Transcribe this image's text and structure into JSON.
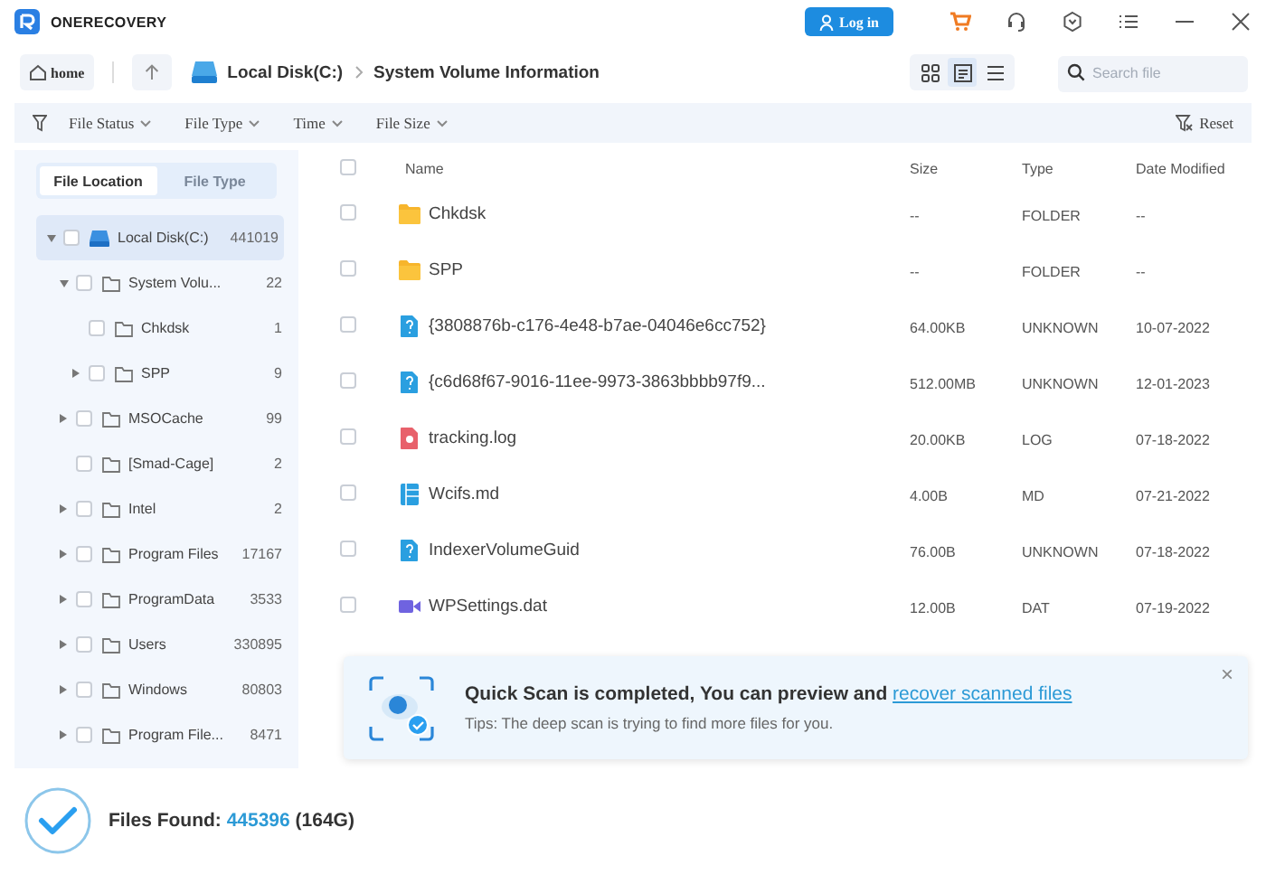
{
  "app": {
    "name": "ONERECOVERY"
  },
  "header": {
    "login": "Log in"
  },
  "toolbar": {
    "home": "home",
    "path": [
      {
        "label": "Local Disk(C:)",
        "kind": "disk"
      },
      {
        "label": "System Volume Information",
        "kind": "folder"
      }
    ],
    "views": [
      {
        "kind": "grid",
        "selected": false
      },
      {
        "kind": "detail",
        "selected": true
      },
      {
        "kind": "list",
        "selected": false
      }
    ],
    "search": {
      "placeholder": "Search file"
    }
  },
  "filters": [
    {
      "label": "File Status"
    },
    {
      "label": "File Type"
    },
    {
      "label": "Time"
    },
    {
      "label": "File Size"
    }
  ],
  "reset": "Reset",
  "sidebar": {
    "tabs": [
      {
        "label": "File Location",
        "selected": true
      },
      {
        "label": "File Type",
        "selected": false
      }
    ],
    "tree": [
      {
        "label": "Local Disk(C:)",
        "count": "441019",
        "kind": "disk",
        "selected": true,
        "checked": false,
        "expandable": true,
        "expanded": true,
        "children": [
          {
            "label": "System Volu...",
            "count": "22",
            "kind": "folder",
            "selected": false,
            "checked": false,
            "expandable": true,
            "expanded": true,
            "children": [
              {
                "label": "Chkdsk",
                "count": "1",
                "kind": "folder",
                "selected": false,
                "checked": false,
                "expandable": false
              },
              {
                "label": "SPP",
                "count": "9",
                "kind": "folder",
                "selected": false,
                "checked": false,
                "expandable": true,
                "expanded": false
              }
            ]
          },
          {
            "label": "MSOCache",
            "count": "99",
            "kind": "folder",
            "selected": false,
            "checked": false,
            "expandable": true,
            "expanded": false
          },
          {
            "label": "[Smad-Cage]",
            "count": "2",
            "kind": "folder",
            "selected": false,
            "checked": false,
            "expandable": false
          },
          {
            "label": "Intel",
            "count": "2",
            "kind": "folder",
            "selected": false,
            "checked": false,
            "expandable": true,
            "expanded": false
          },
          {
            "label": "Program Files",
            "count": "17167",
            "kind": "folder",
            "selected": false,
            "checked": false,
            "expandable": true,
            "expanded": false
          },
          {
            "label": "ProgramData",
            "count": "3533",
            "kind": "folder",
            "selected": false,
            "checked": false,
            "expandable": true,
            "expanded": false
          },
          {
            "label": "Users",
            "count": "330895",
            "kind": "folder",
            "selected": false,
            "checked": false,
            "expandable": true,
            "expanded": false
          },
          {
            "label": "Windows",
            "count": "80803",
            "kind": "folder",
            "selected": false,
            "checked": false,
            "expandable": true,
            "expanded": false
          },
          {
            "label": "Program File...",
            "count": "8471",
            "kind": "folder",
            "selected": false,
            "checked": false,
            "expandable": true,
            "expanded": false
          }
        ]
      }
    ]
  },
  "table": {
    "columns": [
      "Name",
      "Size",
      "Type",
      "Date Modified"
    ],
    "header_checked": false,
    "rows": [
      {
        "name": "Chkdsk",
        "size": "--",
        "type": "FOLDER",
        "date": "--",
        "kind": "folder",
        "checked": false
      },
      {
        "name": "SPP",
        "size": "--",
        "type": "FOLDER",
        "date": "--",
        "kind": "folder",
        "checked": false
      },
      {
        "name": "{3808876b-c176-4e48-b7ae-04046e6cc752}",
        "size": "64.00KB",
        "type": "UNKNOWN",
        "date": "10-07-2022",
        "kind": "unknown",
        "checked": false
      },
      {
        "name": "{c6d68f67-9016-11ee-9973-3863bbbb97f9...",
        "size": "512.00MB",
        "type": "UNKNOWN",
        "date": "12-01-2023",
        "kind": "unknown",
        "checked": false
      },
      {
        "name": "tracking.log",
        "size": "20.00KB",
        "type": "LOG",
        "date": "07-18-2022",
        "kind": "log",
        "checked": false
      },
      {
        "name": "Wcifs.md",
        "size": "4.00B",
        "type": "MD",
        "date": "07-21-2022",
        "kind": "doc",
        "checked": false
      },
      {
        "name": "IndexerVolumeGuid",
        "size": "76.00B",
        "type": "UNKNOWN",
        "date": "07-18-2022",
        "kind": "unknown",
        "checked": false
      },
      {
        "name": "WPSettings.dat",
        "size": "12.00B",
        "type": "DAT",
        "date": "07-19-2022",
        "kind": "video",
        "checked": false
      }
    ]
  },
  "toast": {
    "title": "Quick Scan is completed, You can preview and",
    "link": "recover scanned files",
    "tip": "Tips: The deep scan is trying to find more files for you.",
    "close": "×"
  },
  "footer": {
    "label": "Files Found:",
    "count": "445396",
    "size": "(164G)"
  }
}
